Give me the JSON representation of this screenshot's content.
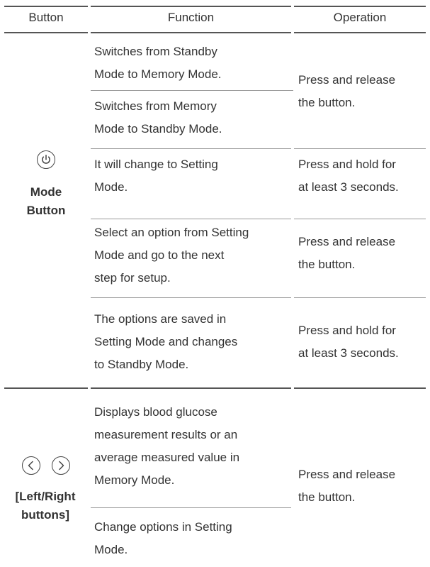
{
  "header": {
    "button": "Button",
    "function": "Function",
    "operation": "Operation"
  },
  "mode_group": {
    "label_line1": "Mode",
    "label_line2": "Button",
    "rows": [
      {
        "function": [
          "Switches from Standby",
          "Mode to Memory Mode."
        ]
      },
      {
        "function": [
          "Switches from Memory",
          "Mode to Standby Mode."
        ]
      },
      {
        "function": [
          "It will change to Setting",
          "Mode."
        ],
        "operation": [
          "Press and hold for",
          "at least 3 seconds."
        ]
      },
      {
        "function": [
          "Select an option from Setting",
          "Mode and go to the next",
          "step for setup."
        ],
        "operation": [
          "Press and release",
          "the button."
        ]
      },
      {
        "function": [
          "The options are saved in",
          "Setting Mode and changes",
          "to Standby Mode."
        ],
        "operation": [
          "Press and hold for",
          "at least 3 seconds."
        ]
      }
    ],
    "operation_rows_1_2": [
      "Press and release",
      "the button."
    ]
  },
  "lr_group": {
    "label_line1": "[Left/Right",
    "label_line2": "buttons]",
    "rows": [
      {
        "function": [
          "Displays blood glucose",
          "measurement results or an",
          "average measured value in",
          "Memory Mode."
        ]
      },
      {
        "function": [
          "Change options in Setting",
          "Mode."
        ]
      }
    ],
    "operation": [
      "Press and release",
      "the button."
    ]
  },
  "icons": [
    "power-icon",
    "chevron-left-icon",
    "chevron-right-icon"
  ]
}
